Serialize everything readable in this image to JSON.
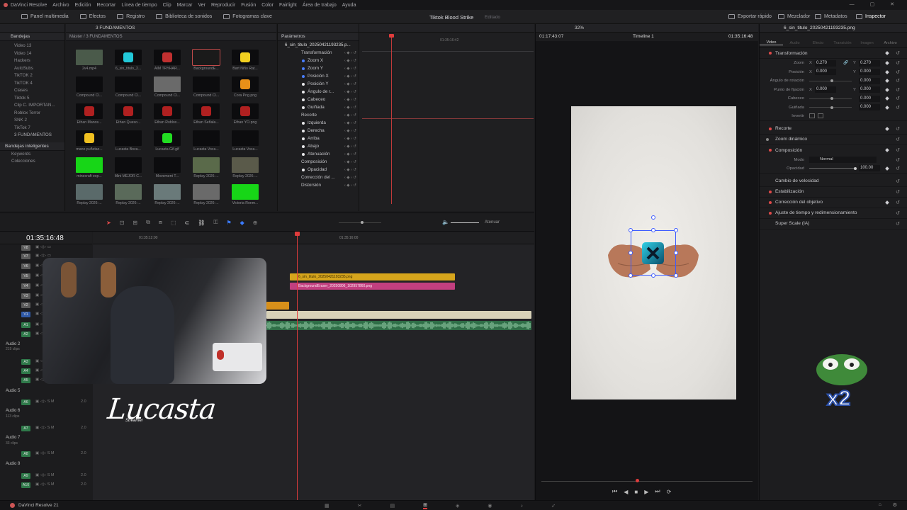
{
  "menu": {
    "app": "DaVinci Resolve",
    "items": [
      "Archivo",
      "Edición",
      "Recortar",
      "Línea de tiempo",
      "Clip",
      "Marcar",
      "Ver",
      "Reproducir",
      "Fusión",
      "Color",
      "Fairlight",
      "Área de trabajo",
      "Ayuda"
    ]
  },
  "toolbar": {
    "media_pool": "Panel multimedia",
    "effects": "Efectos",
    "index": "Registro",
    "sound_lib": "Biblioteca de sonidos",
    "keyframes": "Fotogramas clave",
    "project_title": "Tiktok Blood Strike",
    "project_status": "Editado",
    "quick_export": "Exportar rápido",
    "mixer": "Mezclador",
    "metadata": "Metadatos",
    "inspector": "Inspector"
  },
  "pool": {
    "section": "Bandejas",
    "breadcrumb": "Máster / 3 FUNDAMENTOS",
    "tab": "3 FUNDAMENTOS",
    "bins": [
      "Video 13",
      "Video 14",
      "Hackers",
      "AutoSubs",
      "TikTOK 2",
      "TikTOK 4",
      "Clases",
      "Tiktok 5",
      "Clip C. IMPORTAN...",
      "Roblox Terror",
      "SNK 2",
      "TikTok 7",
      "3 FUNDAMENTOS"
    ],
    "smart_bins": "Bandejas inteligentes",
    "keywords": "Keywords",
    "collections": "Colecciones",
    "clips": [
      "2v4.mp4",
      "6_sin_titulo_2...",
      "AIM TRYHAR...",
      "BackgroundE...",
      "Bart Niño Rat...",
      "Compound Cl...",
      "Compound Cl...",
      "Compound Cl...",
      "Compound Cl...",
      "Cora Png.png",
      "Ethan Manos...",
      "Ethan Queso...",
      "Ethan Roblox...",
      "Ethan Señala...",
      "Ethan YO.png",
      "mano puñetaz...",
      "Lucasta Boca...",
      "Lucasta Gif.gif",
      "Lucasta Voca...",
      "Lucasta Voca...",
      "minecraft exp...",
      "Mini MEJOR C...",
      "Movement T...",
      "Replay 2026-...",
      "Replay 2026-...",
      "Replay 2026-...",
      "Replay 2026-...",
      "Replay 2026-...",
      "Replay 2026-...",
      "Victoria Ronm..."
    ]
  },
  "params": {
    "title": "Parámetros",
    "clip": "6_sin_titulo_20250421193235.p...",
    "groups": [
      "Transformación",
      "Zoom X",
      "Zoom Y",
      "Posición X",
      "Posición Y",
      "Ángulo de r...",
      "Cabeceo",
      "Guiñada",
      "Recorte",
      "Izquierda",
      "Derecha",
      "Arriba",
      "Abajo",
      "Atenuación",
      "Composición",
      "Opacidad",
      "Corrección del ...",
      "Distorsión"
    ],
    "ruler_tc": "01:35:16:42"
  },
  "timeline": {
    "timecode": "01:35:16:48",
    "ruler_tc1": "01:35:12:00",
    "ruler_tc2": "01:35:16:00",
    "attenuate": "Atenuar",
    "tracks": [
      "V8",
      "V7",
      "V6",
      "V5",
      "V4",
      "V3",
      "V2",
      "V1",
      "A1",
      "A2",
      "Audio 2",
      "219 clips",
      "A3",
      "A4",
      "A5",
      "Audio 5",
      "A6",
      "Audio 6",
      "113 clips",
      "A7",
      "Audio 7",
      "33 clips",
      "A8",
      "Audio 8",
      "A9",
      "A10"
    ],
    "clip_v5": "6_sin_titulo_20250421193235.png",
    "clip_v4": "BackgroundEraser_20250806_102957860.png",
    "vol": "2.0",
    "watermark": "Lucasta",
    "watermark_sub": "Streamer"
  },
  "viewer": {
    "zoom": "32%",
    "tc_left": "01:17:43:07",
    "timeline": "Timeline 1",
    "tc_right": "01:35:16:48"
  },
  "inspector": {
    "clip": "6_sin_titulo_20250421193235.png",
    "tabs": [
      "Video",
      "Audio",
      "Efecto",
      "Transición",
      "Imagen",
      "Archivo"
    ],
    "transform": "Transformación",
    "zoom": "Zoom",
    "zoom_x": "0.270",
    "zoom_y": "0.270",
    "position": "Posición",
    "pos_x": "0.000",
    "pos_y": "0.000",
    "rotation": "Ángulo de rotación",
    "rot": "0.000",
    "anchor": "Punto de fijación",
    "anchor_x": "0.000",
    "anchor_y": "0.000",
    "pitch": "Cabeceo",
    "pitch_v": "0.000",
    "yaw": "Guiñada",
    "yaw_v": "0.000",
    "flip": "Invertir",
    "crop": "Recorte",
    "dyn_zoom": "Zoom dinámico",
    "comp": "Composición",
    "mode_lbl": "Modo",
    "mode": "Normal",
    "opacity_lbl": "Opacidad",
    "opacity": "100.00",
    "speed": "Cambio de velocidad",
    "stab": "Estabilización",
    "lens": "Corrección del objetivo",
    "retime": "Ajuste de tiempo y redimensionamiento",
    "superscale": "Super Scale (IA)"
  },
  "overlay": {
    "multiplier": "x2"
  },
  "footer": {
    "app": "DaVinci Resolve 21"
  },
  "colors": {
    "accent": "#e04a4a",
    "v5_clip": "#d6a51c",
    "v4_clip": "#c23f7f",
    "audio": "#3d8f5c",
    "playhead": "#e03c3c"
  }
}
